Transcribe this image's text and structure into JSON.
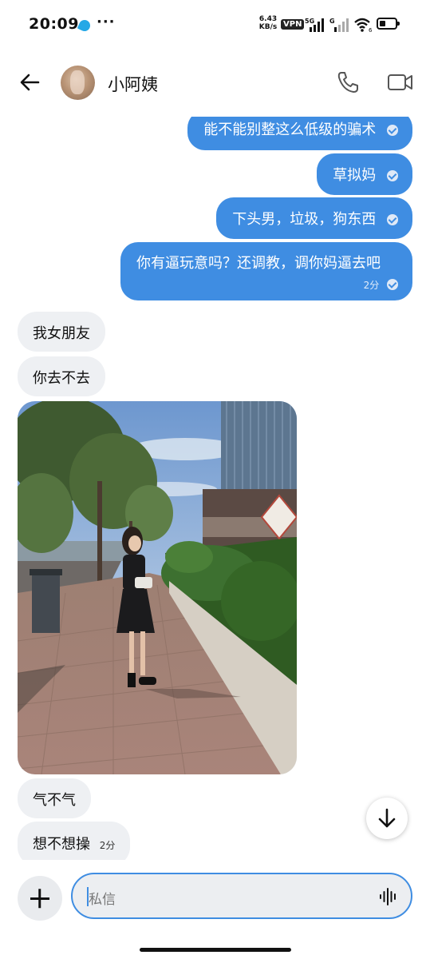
{
  "status_bar": {
    "time": "20:09",
    "more": "···",
    "net_speed_value": "6.43",
    "net_speed_unit": "KB/s",
    "vpn": "VPN",
    "sig1_label": "5G",
    "sig2_label": "G",
    "wifi_sub": "6"
  },
  "header": {
    "contact_name": "小阿姨"
  },
  "messages": {
    "out": [
      {
        "text": "能不能别整这么低级的骗术"
      },
      {
        "text": "草拟妈"
      },
      {
        "text": "下头男，垃圾，狗东西"
      },
      {
        "text": "你有逼玩意吗？还调教，调你妈逼去吧",
        "time": "2分"
      }
    ],
    "in": [
      {
        "text": "我女朋友"
      },
      {
        "text": "你去不去"
      },
      {
        "text": "气不气"
      },
      {
        "text": "想不想操",
        "time": "2分"
      }
    ]
  },
  "composer": {
    "placeholder": "私信"
  },
  "colors": {
    "accent": "#3f8de2",
    "incoming_bubble": "#eef0f3"
  }
}
